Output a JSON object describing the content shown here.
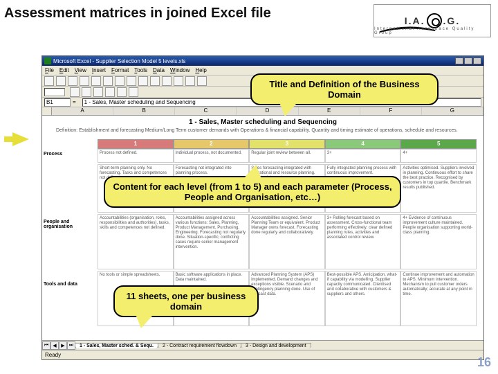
{
  "slide": {
    "title": "Assessment matrices in joined Excel file",
    "number": "16"
  },
  "logo": {
    "left": "I.A.",
    "right": ".G.",
    "sub": "International Aerospace Quality Group"
  },
  "callouts": [
    "Title and Definition of the Business Domain",
    "Content for each level (from 1 to 5) and each parameter (Process, People and Organisation, etc…)",
    "11 sheets, one per business domain"
  ],
  "excel": {
    "window_title": "Microsoft Excel - Supplier Selection Model 5 levels.xls",
    "menu": [
      "File",
      "Edit",
      "View",
      "Insert",
      "Format",
      "Tools",
      "Data",
      "Window",
      "Help"
    ],
    "active_cell": "B1",
    "formula_text": "1 - Sales, Master scheduling and Sequencing",
    "cols": [
      "A",
      "B",
      "C",
      "D",
      "E",
      "F",
      "G"
    ],
    "sheet_heading": "1 - Sales, Master scheduling and Sequencing",
    "sheet_desc": "Definition: Establishment and forecasting Medium/Long Term customer demands with Operations & financial capability. Quantity and timing estimate of operations, schedule and resources.",
    "levels": [
      "1",
      "2",
      "3",
      "4",
      "5"
    ],
    "params": [
      "Process",
      "People and organisation",
      "Tools and data"
    ],
    "crit": [
      "Process not defined.",
      "Individual process, not documented.",
      "Regular joint review between all.",
      "3+",
      "4+"
    ],
    "process": [
      "Short-term planning only. No forecasting. Tasks and competences not defined.",
      "Forecasting not integrated into planning process.",
      "Sales forecasting integrated with operational and resource planning. Regular joint reviews.",
      "Fully integrated planning process with continuous improvement.",
      "Activities optimised. Suppliers involved in planning. Continuous effort to share the best practice. Recognised by customers in top quartile. Benchmark results published."
    ],
    "people": [
      "Accountabilities (organisation, roles, responsibilities and authorities), tasks, skills and competences not defined.",
      "Accountabilities assigned across various functions: Sales, Planning, Product Management, Purchasing, Engineering. Forecasting not regularly done. Situation-specific; conflicting cases require senior management intervention.",
      "Accountabilities assigned. Senior Planning Team or equivalent. Product Manager owns forecast. Forecasting done regularly and collaboratively.",
      "3+ Rolling forecast based on assessment. Cross-functional team performing effectively; clear defined planning rules, activities and associated control review.",
      "4+ Evidence of continuous improvement culture maintained. People organisation supporting world-class planning."
    ],
    "tools": [
      "No tools or simple spreadsheets.",
      "Basic software applications in place. Data maintained.",
      "Advanced Planning System (APS) implemented. Demand changes and exceptions visible. Scenario and contingency planning done. Use of forecast data.",
      "Best-possible APS. Anticipation, what-if capability via modelling. Supplier capacity communicated. Clientised and collaborative with customers & suppliers and others.",
      "Continue improvement and automation to APS. Minimum intervention. Mechanism to pull customer orders automatically; accurate at any point in time."
    ],
    "tabs": [
      "1 - Sales, Master sched. & Sequ.",
      "2 - Contract requirement flowdown",
      "3 - Design and development"
    ],
    "status": "Ready"
  }
}
